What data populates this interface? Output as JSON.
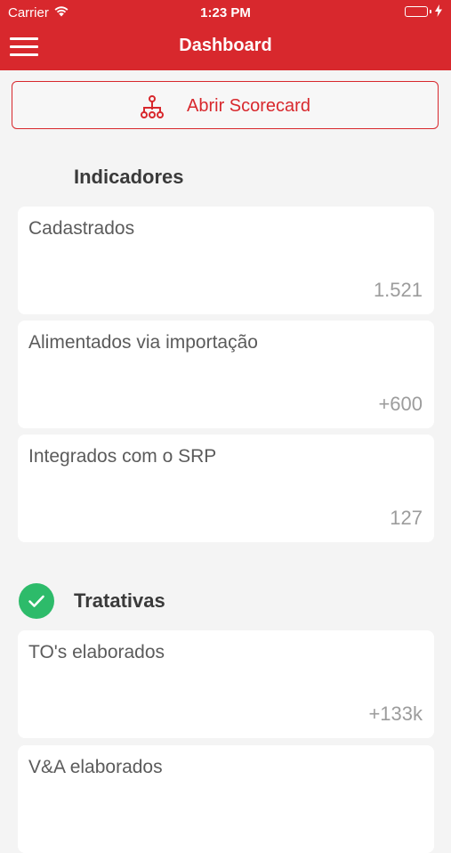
{
  "status_bar": {
    "carrier": "Carrier",
    "time": "1:23 PM",
    "battery_color": "#3fd15b"
  },
  "navbar": {
    "title": "Dashboard",
    "menu_icon": "hamburger-menu-icon",
    "background": "#d8282d"
  },
  "scorecard_button": {
    "label": "Abrir Scorecard",
    "icon": "hierarchy-icon"
  },
  "indicadores": {
    "title": "Indicadores",
    "cards": [
      {
        "label": "Cadastrados",
        "value": "1.521"
      },
      {
        "label": "Alimentados via importação",
        "value": "+600"
      },
      {
        "label": "Integrados com o SRP",
        "value": "127"
      }
    ]
  },
  "tratativas": {
    "title": "Tratativas",
    "status_icon": "check-circle-icon",
    "status_color": "#2dbb6a",
    "cards": [
      {
        "label": "TO's elaborados",
        "value": "+133k"
      },
      {
        "label": "V&A elaborados",
        "value": ""
      }
    ]
  }
}
